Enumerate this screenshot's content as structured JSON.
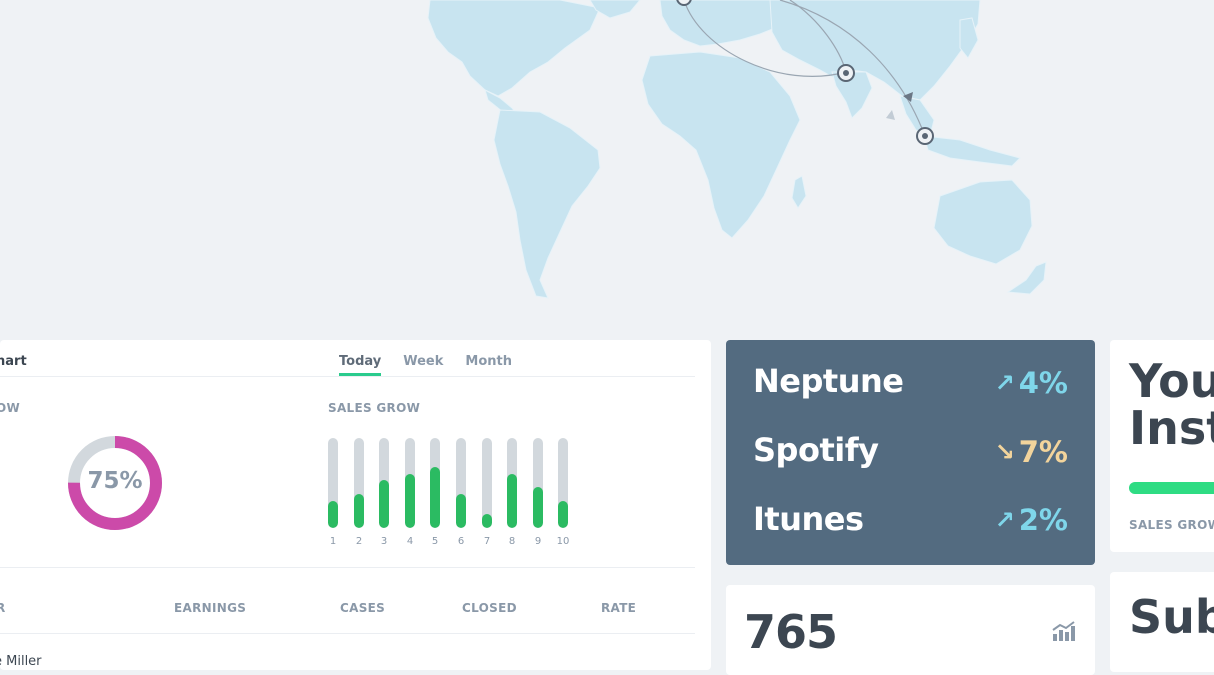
{
  "colors": {
    "background": "#eff2f5",
    "map_land": "#c8e4f0",
    "stats_panel": "#536b80",
    "tab_active_underline": "#2bcb8d",
    "bar_fill": "#2bbb62",
    "bar_track": "#d2d8dd",
    "donut_value": "#cc4aa9",
    "donut_track": "#d2d8dd",
    "arrow_up": "#7fd6ea",
    "arrow_down": "#f2d49c",
    "progress_fill": "#2edc83"
  },
  "map": {
    "markers": [
      "target-marker-india",
      "target-marker-singapore",
      "target-marker-europe"
    ],
    "routes": [
      "route-europe-india",
      "route-europe-singapore"
    ]
  },
  "chart_panel": {
    "title": "hart",
    "tabs": [
      {
        "label": "Today",
        "active": true
      },
      {
        "label": "Week",
        "active": false
      },
      {
        "label": "Month",
        "active": false
      }
    ],
    "donut_section_label": "OW",
    "donut_percent": 75,
    "donut_label": "75%",
    "bar_section_label": "SALES GROW"
  },
  "chart_data": {
    "type": "bar",
    "categories": [
      "1",
      "2",
      "3",
      "4",
      "5",
      "6",
      "7",
      "8",
      "9",
      "10"
    ],
    "values": [
      30,
      38,
      53,
      60,
      68,
      38,
      15,
      60,
      45,
      30
    ],
    "ylim": [
      0,
      100
    ],
    "title": "SALES GROW",
    "xlabel": "",
    "ylabel": ""
  },
  "table": {
    "headers": [
      "R",
      "EARNINGS",
      "CASES",
      "CLOSED",
      "RATE"
    ],
    "first_row_name": "e Miller"
  },
  "stats": [
    {
      "name": "Neptune",
      "change": "4%",
      "direction": "up",
      "arrow": "↗"
    },
    {
      "name": "Spotify",
      "change": "7%",
      "direction": "down",
      "arrow": "↘"
    },
    {
      "name": "Itunes",
      "change": "2%",
      "direction": "up",
      "arrow": "↗"
    }
  ],
  "counter": {
    "value": "765",
    "icon": "trend-chart-icon"
  },
  "right_panel": {
    "title": "You\nInst",
    "progress": 0.85,
    "label": "SALES GROW"
  },
  "sub_panel": {
    "title": "Sub"
  }
}
